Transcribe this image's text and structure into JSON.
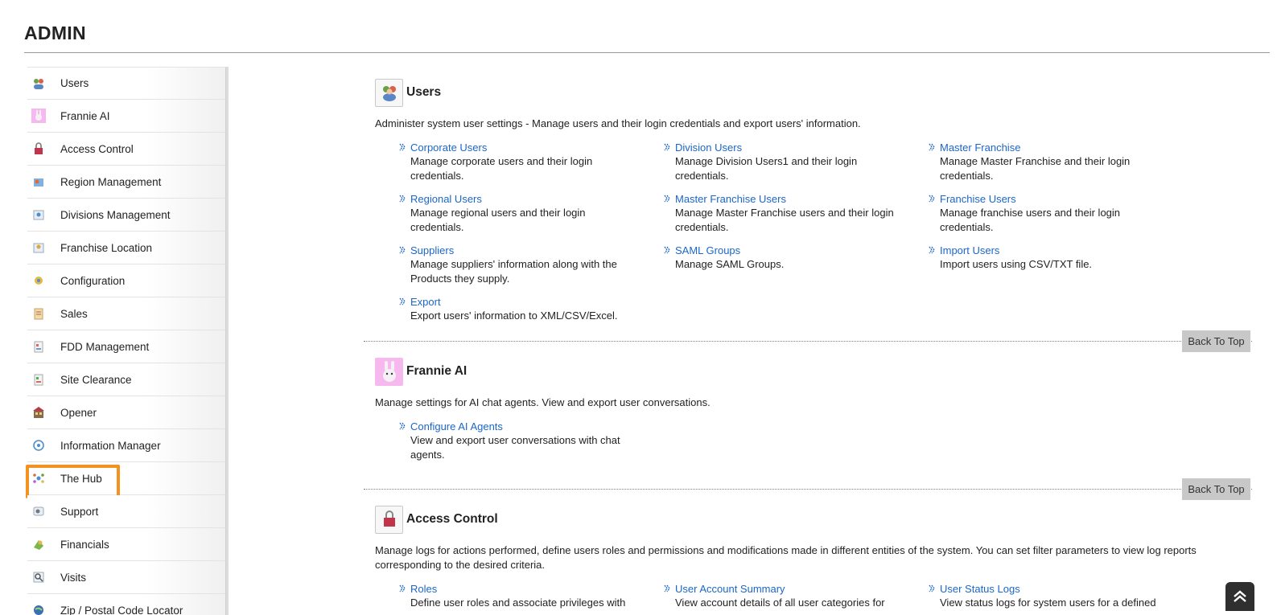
{
  "page": {
    "title": "ADMIN"
  },
  "sidebar": {
    "items": [
      {
        "label": "Users",
        "icon": "users-icon"
      },
      {
        "label": "Frannie AI",
        "icon": "bunny-icon"
      },
      {
        "label": "Access Control",
        "icon": "lock-icon"
      },
      {
        "label": "Region Management",
        "icon": "region-icon"
      },
      {
        "label": "Divisions Management",
        "icon": "divisions-icon"
      },
      {
        "label": "Franchise Location",
        "icon": "location-icon"
      },
      {
        "label": "Configuration",
        "icon": "config-icon"
      },
      {
        "label": "Sales",
        "icon": "sales-icon"
      },
      {
        "label": "FDD Management",
        "icon": "fdd-icon"
      },
      {
        "label": "Site Clearance",
        "icon": "site-icon"
      },
      {
        "label": "Opener",
        "icon": "opener-icon"
      },
      {
        "label": "Information Manager",
        "icon": "info-manager-icon"
      },
      {
        "label": "The Hub",
        "icon": "hub-icon"
      },
      {
        "label": "Support",
        "icon": "support-icon"
      },
      {
        "label": "Financials",
        "icon": "financials-icon"
      },
      {
        "label": "Visits",
        "icon": "visits-icon"
      },
      {
        "label": "Zip / Postal Code Locator",
        "icon": "globe-icon"
      }
    ]
  },
  "sections": {
    "users": {
      "title": "Users",
      "description": "Administer system user settings - Manage users and their login credentials and export users' information.",
      "links": [
        {
          "label": "Corporate Users",
          "desc": "Manage corporate users and their login credentials."
        },
        {
          "label": "Division Users",
          "desc": "Manage Division Users1 and their login credentials."
        },
        {
          "label": "Master Franchise",
          "desc": "Manage Master Franchise and their login credentials."
        },
        {
          "label": "Regional Users",
          "desc": "Manage regional users and their login credentials."
        },
        {
          "label": "Master Franchise Users",
          "desc": "Manage Master Franchise users and their login credentials."
        },
        {
          "label": "Franchise Users",
          "desc": "Manage franchise users and their login credentials."
        },
        {
          "label": "Suppliers",
          "desc": "Manage suppliers' information along with the Products they supply."
        },
        {
          "label": "SAML Groups",
          "desc": "Manage SAML Groups."
        },
        {
          "label": "Import Users",
          "desc": "Import users using CSV/TXT file."
        },
        {
          "label": "Export",
          "desc": "Export users' information to XML/CSV/Excel."
        }
      ]
    },
    "frannie": {
      "title": "Frannie AI",
      "description": "Manage settings for AI chat agents. View and export user conversations.",
      "links": [
        {
          "label": "Configure AI Agents",
          "desc": "View and export user conversations with chat agents."
        }
      ]
    },
    "access": {
      "title": "Access Control",
      "description": "Manage logs for actions performed, define users roles and permissions and modifications made in different entities of the system. You can set filter parameters to view log reports corresponding to the desired criteria.",
      "links": [
        {
          "label": "Roles",
          "desc": "Define user roles and associate privileges with"
        },
        {
          "label": "User Account Summary",
          "desc": "View account details of all user categories for"
        },
        {
          "label": "User Status Logs",
          "desc": "View status logs for system users for a defined"
        }
      ]
    }
  },
  "back_to_top": "Back To Top",
  "colors": {
    "link": "#1b66c9",
    "highlight": "#f39220"
  }
}
